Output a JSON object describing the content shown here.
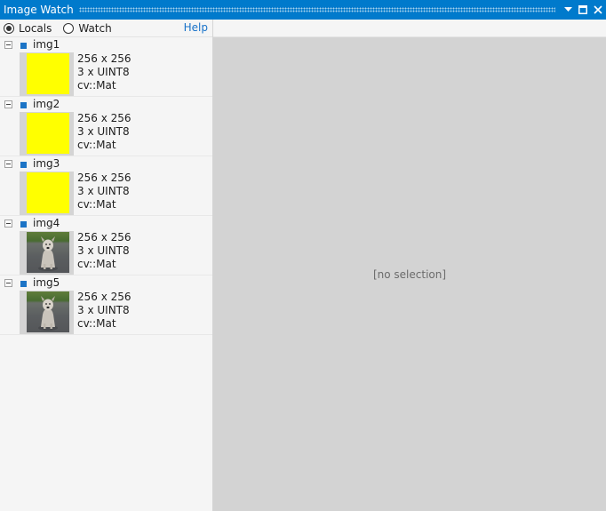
{
  "window": {
    "title": "Image Watch",
    "accent_color": "#007acc",
    "buttons": [
      "dropdown-icon",
      "maximize-icon",
      "close-icon"
    ]
  },
  "toolbar": {
    "locals_label": "Locals",
    "watch_label": "Watch",
    "selected": "Locals",
    "help_label": "Help"
  },
  "images": [
    {
      "name": "img1",
      "size": "256 x 256",
      "format": "3 x UINT8",
      "type": "cv::Mat",
      "thumbnail": "yellow-fill"
    },
    {
      "name": "img2",
      "size": "256 x 256",
      "format": "3 x UINT8",
      "type": "cv::Mat",
      "thumbnail": "yellow-fill"
    },
    {
      "name": "img3",
      "size": "256 x 256",
      "format": "3 x UINT8",
      "type": "cv::Mat",
      "thumbnail": "yellow-fill"
    },
    {
      "name": "img4",
      "size": "256 x 256",
      "format": "3 x UINT8",
      "type": "cv::Mat",
      "thumbnail": "dog-photo"
    },
    {
      "name": "img5",
      "size": "256 x 256",
      "format": "3 x UINT8",
      "type": "cv::Mat",
      "thumbnail": "dog-photo"
    }
  ],
  "viewer": {
    "placeholder": "[no selection]"
  },
  "colors": {
    "thumbnail_yellow": "#ffff00",
    "marker_blue": "#1c74c6",
    "help_link": "#1a73c9"
  }
}
